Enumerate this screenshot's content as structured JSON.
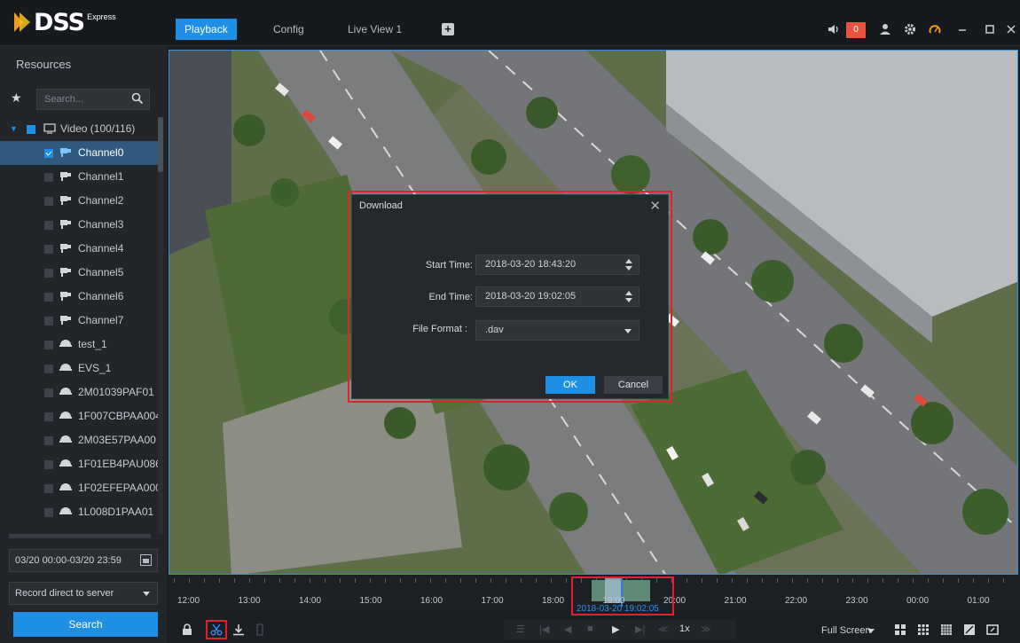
{
  "app": {
    "brand": "DSS",
    "edition": "Express"
  },
  "tabs": [
    {
      "label": "Playback",
      "active": true
    },
    {
      "label": "Config",
      "active": false
    },
    {
      "label": "Live View 1",
      "active": false
    }
  ],
  "header": {
    "alarm_count": "0",
    "accent": "#1f8fe6"
  },
  "sidebar": {
    "title": "Resources",
    "search_placeholder": "Search...",
    "tree": {
      "root_label": "Video (100/116)",
      "items": [
        {
          "label": "Channel0",
          "type": "camera",
          "checked": true
        },
        {
          "label": "Channel1",
          "type": "camera",
          "checked": false
        },
        {
          "label": "Channel2",
          "type": "camera",
          "checked": false
        },
        {
          "label": "Channel3",
          "type": "camera",
          "checked": false
        },
        {
          "label": "Channel4",
          "type": "camera",
          "checked": false
        },
        {
          "label": "Channel5",
          "type": "camera",
          "checked": false
        },
        {
          "label": "Channel6",
          "type": "camera",
          "checked": false
        },
        {
          "label": "Channel7",
          "type": "camera",
          "checked": false
        },
        {
          "label": "test_1",
          "type": "dome",
          "checked": false
        },
        {
          "label": "EVS_1",
          "type": "dome",
          "checked": false
        },
        {
          "label": "2M01039PAF01",
          "type": "dome",
          "checked": false
        },
        {
          "label": "1F007CBPAA004",
          "type": "dome",
          "checked": false
        },
        {
          "label": "2M03E57PAA00",
          "type": "dome",
          "checked": false
        },
        {
          "label": "1F01EB4PAU086",
          "type": "dome",
          "checked": false
        },
        {
          "label": "1F02EFEPAA000",
          "type": "dome",
          "checked": false
        },
        {
          "label": "1L008D1PAA01",
          "type": "dome",
          "checked": false
        }
      ]
    },
    "date_range": "03/20 00:00-03/20 23:59",
    "record_source": "Record direct to server",
    "search_button": "Search"
  },
  "dialog": {
    "title": "Download",
    "start_label": "Start Time:",
    "start_value": "2018-03-20 18:43:20",
    "end_label": "End Time:",
    "end_value": "2018-03-20 19:02:05",
    "format_label": "File Format :",
    "format_value": ".dav",
    "ok": "OK",
    "cancel": "Cancel"
  },
  "timeline": {
    "hours": [
      "12:00",
      "13:00",
      "14:00",
      "15:00",
      "16:00",
      "17:00",
      "18:00",
      "19:00",
      "20:00",
      "21:00",
      "22:00",
      "23:00",
      "00:00",
      "01:00"
    ],
    "current_time": "2018-03-20 19:02:05"
  },
  "toolbar": {
    "speed": "1x",
    "window_mode": "Full Screen"
  }
}
